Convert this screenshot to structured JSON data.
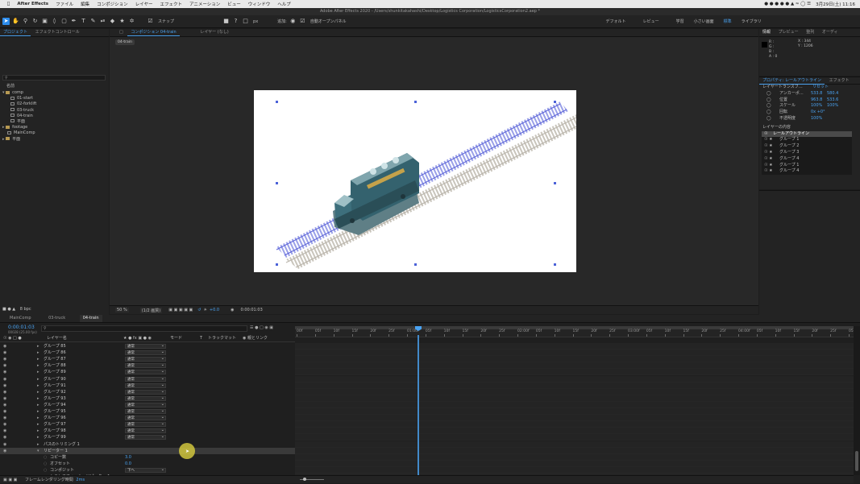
{
  "macbar": {
    "app_name": "After Effects",
    "menus": [
      "ファイル",
      "編集",
      "コンポジション",
      "レイヤー",
      "エフェクト",
      "アニメーション",
      "ビュー",
      "ウィンドウ",
      "ヘルプ"
    ],
    "date_time": "3月29日(土) 11:16"
  },
  "titlebar": {
    "title": "Adobe After Effects 2020 - /Users/shunkitakahashi/Desktop/Logistics Corporation/LogisticsCorporation2.aep *"
  },
  "toolbar": {
    "snap_label": "スナップ",
    "add_label": "追加:",
    "auto_open_label": "自動オープンパネル",
    "px_label": "px",
    "workspaces": [
      "デフォルト",
      "レビュー",
      "学習",
      "小さい画面",
      "標準",
      "ライブラリ"
    ],
    "active_workspace": "標準"
  },
  "project_panel": {
    "tabs": [
      "プロジェクト",
      "エフェクトコントロール"
    ],
    "search_placeholder": "",
    "column_name": "名前",
    "items": [
      {
        "name": "comp",
        "kind": "folder",
        "level": 0
      },
      {
        "name": "01-start",
        "kind": "comp",
        "level": 1
      },
      {
        "name": "02-forklift",
        "kind": "comp",
        "level": 1
      },
      {
        "name": "03-truck",
        "kind": "comp",
        "level": 1
      },
      {
        "name": "04-train",
        "kind": "comp",
        "level": 1
      },
      {
        "name": "平面",
        "kind": "comp",
        "level": 1
      },
      {
        "name": "footage",
        "kind": "folder",
        "level": 0
      },
      {
        "name": "MainComp",
        "kind": "comp",
        "level": 0
      },
      {
        "name": "平面",
        "kind": "folder",
        "level": 0
      }
    ],
    "bpc_label": "8 bpc"
  },
  "composition_panel": {
    "tab_label": "コンポジション 04-train",
    "layer_tab": "レイヤー (なし)",
    "flow_tag": "04-train",
    "zoom": "50 %",
    "resolution": "(1/2 画質)",
    "timecode": "0:00:01:03",
    "exposure": "+0.0"
  },
  "info_panel": {
    "tabs": [
      "情報",
      "プレビュー",
      "整列",
      "オーディ"
    ],
    "r": "R :",
    "g": "G :",
    "b": "B :",
    "a": "A : 0",
    "x": "X : 344",
    "y": "Y : 1206"
  },
  "properties_panel": {
    "tabs": [
      "プロパティ: レールアウトライン",
      "エフェクト"
    ],
    "transform_label": "レイヤートランスフ…",
    "reset_label": "リセット",
    "props": [
      {
        "name": "アンカーポ…",
        "v1": "533.8",
        "v2": "580.4"
      },
      {
        "name": "位置",
        "v1": "963.8",
        "v2": "533.6"
      },
      {
        "name": "スケール",
        "v1": "100%",
        "v2": "100%"
      },
      {
        "name": "回転",
        "v1": "0x +0°",
        "v2": ""
      },
      {
        "name": "不透明度",
        "v1": "100%",
        "v2": ""
      }
    ],
    "contents_label": "レイヤーの内容",
    "contents": [
      "レールアウトライン",
      "グループ 1",
      "グループ 2",
      "グループ 3",
      "グループ 4",
      "グループ 1",
      "グループ 4"
    ]
  },
  "timeline": {
    "tabs": [
      "MainComp",
      "03-truck",
      "04-train"
    ],
    "active_tab": "04-train",
    "timecode": "0:00:01:03",
    "timecode_sub": "00028 (25.00 fps)",
    "col_layer": "レイヤー名",
    "col_mode": "モード",
    "col_t": "T",
    "col_track": "トラックマット",
    "col_parent": "親とリンク",
    "layers": [
      {
        "name": "グループ 85",
        "mode": "通常",
        "level": 1
      },
      {
        "name": "グループ 86",
        "mode": "通常",
        "level": 1
      },
      {
        "name": "グループ 87",
        "mode": "通常",
        "level": 1
      },
      {
        "name": "グループ 88",
        "mode": "通常",
        "level": 1
      },
      {
        "name": "グループ 89",
        "mode": "通常",
        "level": 1
      },
      {
        "name": "グループ 90",
        "mode": "通常",
        "level": 1
      },
      {
        "name": "グループ 91",
        "mode": "通常",
        "level": 1
      },
      {
        "name": "グループ 92",
        "mode": "通常",
        "level": 1
      },
      {
        "name": "グループ 93",
        "mode": "通常",
        "level": 1
      },
      {
        "name": "グループ 94",
        "mode": "通常",
        "level": 1
      },
      {
        "name": "グループ 95",
        "mode": "通常",
        "level": 1
      },
      {
        "name": "グループ 96",
        "mode": "通常",
        "level": 1
      },
      {
        "name": "グループ 97",
        "mode": "通常",
        "level": 1
      },
      {
        "name": "グループ 98",
        "mode": "通常",
        "level": 1
      },
      {
        "name": "グループ 99",
        "mode": "通常",
        "level": 1
      },
      {
        "name": "パスのトリミング 1",
        "mode": "",
        "level": 1
      },
      {
        "name": "リピーター 1",
        "mode": "",
        "level": 1
      },
      {
        "name": "コピー数",
        "mode": "",
        "level": 2,
        "value": "3.0"
      },
      {
        "name": "オフセット",
        "mode": "",
        "level": 2,
        "value": "0.0"
      },
      {
        "name": "コンポジット",
        "mode": "下へ",
        "level": 2
      },
      {
        "name": "トランスフォーム : リピーター 1",
        "mode": "",
        "level": 2
      }
    ],
    "footer_label": "フレームレンダリング時間",
    "footer_value": "2ms",
    "ruler_ticks": [
      "00f",
      "05f",
      "10f",
      "15f",
      "20f",
      "25f",
      "01:00f",
      "05f",
      "10f",
      "15f",
      "20f",
      "25f",
      "02:00f",
      "05f",
      "10f",
      "15f",
      "20f",
      "25f",
      "03:00f",
      "05f",
      "10f",
      "15f",
      "20f",
      "25f",
      "04:00f",
      "05f",
      "10f",
      "15f",
      "20f",
      "25f",
      "05:0"
    ]
  }
}
